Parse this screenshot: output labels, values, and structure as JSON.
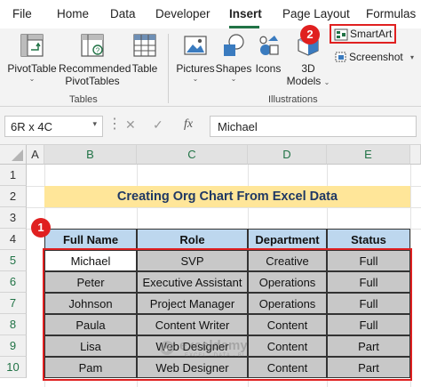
{
  "menu": {
    "tabs": [
      "File",
      "Home",
      "Data",
      "Developer",
      "Insert",
      "Page Layout",
      "Formulas"
    ],
    "active_tab": "Insert"
  },
  "ribbon": {
    "tables_group": {
      "label": "Tables",
      "pivot_table": "PivotTable",
      "recommended_line1": "Recommended",
      "recommended_line2": "PivotTables",
      "table": "Table"
    },
    "illustrations_group": {
      "label": "Illustrations",
      "pictures": "Pictures",
      "shapes": "Shapes",
      "icons": "Icons",
      "models_line1": "3D",
      "models_line2": "Models",
      "smartart": "SmartArt",
      "screenshot": "Screenshot"
    },
    "chevron": "⌄",
    "dropdown": "▾"
  },
  "formula_bar": {
    "name_box": "6R x 4C",
    "formula": "Michael",
    "fx": "fx"
  },
  "sheet": {
    "columns": [
      "A",
      "B",
      "C",
      "D",
      "E"
    ],
    "rows": [
      "1",
      "2",
      "3",
      "4",
      "5",
      "6",
      "7",
      "8",
      "9",
      "10"
    ],
    "title": "Creating Org Chart From Excel Data",
    "headers": [
      "Full Name",
      "Role",
      "Department",
      "Status"
    ],
    "data": [
      [
        "Michael",
        "SVP",
        "Creative",
        "Full"
      ],
      [
        "Peter",
        "Executive Assistant",
        "Operations",
        "Full"
      ],
      [
        "Johnson",
        "Project Manager",
        "Operations",
        "Full"
      ],
      [
        "Paula",
        "Content Writer",
        "Content",
        "Full"
      ],
      [
        "Lisa",
        "Web Designer",
        "Content",
        "Part"
      ],
      [
        "Pam",
        "Web Designer",
        "Content",
        "Part"
      ]
    ]
  },
  "annotations": {
    "step1": "1",
    "step2": "2"
  },
  "watermark": {
    "name": "exceldemy",
    "tagline": "EXCEL · DATA · BI"
  },
  "colors": {
    "title_fill": "#FFE699",
    "header_fill": "#BDD7EE",
    "selected_fill": "#C8C8C8",
    "active_cell_fill": "#FFFFFF",
    "accent_green": "#217346",
    "highlight_red": "#E02020"
  }
}
